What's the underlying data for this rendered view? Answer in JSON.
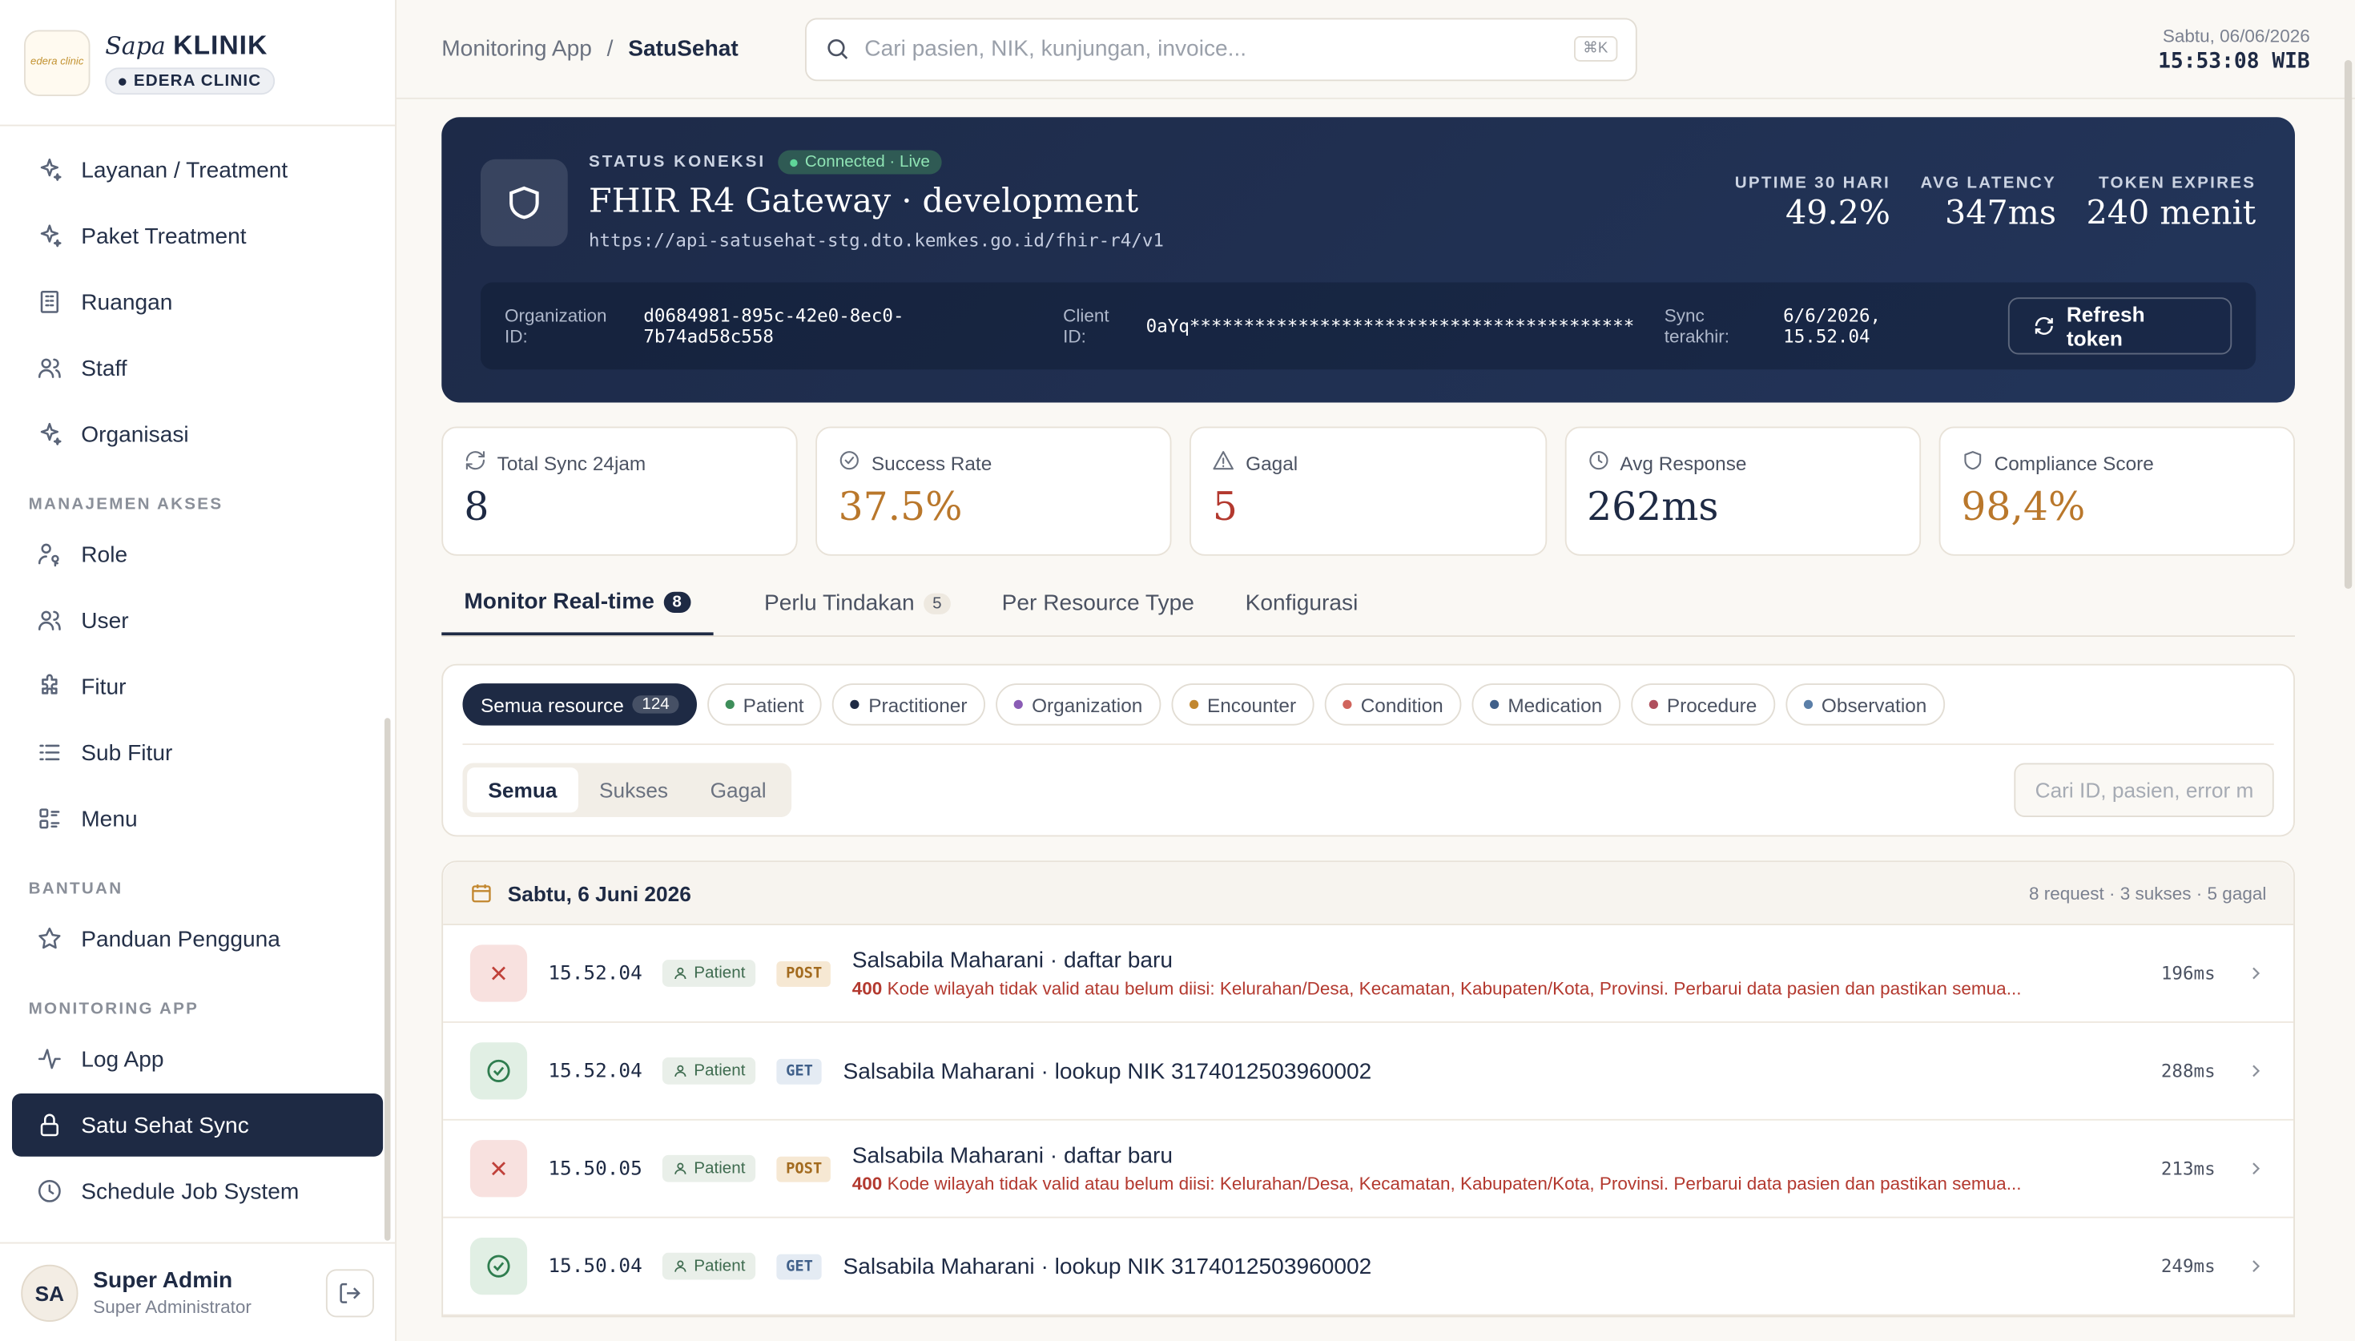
{
  "brand": {
    "name_italic": "Sapa",
    "name_bold": "KLINIK",
    "clinic": "EDERA CLINIC",
    "logo_text": "edera clinic"
  },
  "sidebar": {
    "items_top": [
      {
        "label": "Layanan / Treatment",
        "icon": "sparkle-icon"
      },
      {
        "label": "Paket Treatment",
        "icon": "sparkle-icon"
      },
      {
        "label": "Ruangan",
        "icon": "building-icon"
      },
      {
        "label": "Staff",
        "icon": "users-icon"
      },
      {
        "label": "Organisasi",
        "icon": "sparkle-icon"
      }
    ],
    "section_akses": "MANAJEMEN AKSES",
    "items_akses": [
      {
        "label": "Role",
        "icon": "user-key-icon"
      },
      {
        "label": "User",
        "icon": "users-icon"
      },
      {
        "label": "Fitur",
        "icon": "puzzle-icon"
      },
      {
        "label": "Sub Fitur",
        "icon": "list-icon"
      },
      {
        "label": "Menu",
        "icon": "menu-grid-icon"
      }
    ],
    "section_bantuan": "BANTUAN",
    "items_bantuan": [
      {
        "label": "Panduan Pengguna",
        "icon": "star-icon"
      }
    ],
    "section_monitoring": "MONITORING APP",
    "items_monitoring": [
      {
        "label": "Log App",
        "icon": "activity-icon"
      },
      {
        "label": "Satu Sehat Sync",
        "icon": "lock-icon",
        "active": true
      },
      {
        "label": "Schedule Job System",
        "icon": "clock-icon"
      }
    ]
  },
  "user": {
    "initials": "SA",
    "name": "Super Admin",
    "role": "Super Administrator"
  },
  "topbar": {
    "crumb_parent": "Monitoring App",
    "crumb_sep": "/",
    "crumb_current": "SatuSehat",
    "search_placeholder": "Cari pasien, NIK, kunjungan, invoice...",
    "shortcut": "⌘K",
    "date": "Sabtu, 06/06/2026",
    "time": "15:53:08 WIB"
  },
  "hero": {
    "status_label": "STATUS KONEKSI",
    "status_pill": "Connected · Live",
    "gateway": "FHIR R4 Gateway · development",
    "url": "https://api-satusehat-stg.dto.kemkes.go.id/fhir-r4/v1",
    "metrics": [
      {
        "label": "UPTIME 30 HARI",
        "value": "49.2%"
      },
      {
        "label": "AVG LATENCY",
        "value": "347ms"
      },
      {
        "label": "TOKEN EXPIRES",
        "value": "240 menit"
      }
    ],
    "org_label": "Organization ID:",
    "org_value": "d0684981-895c-42e0-8ec0-7b74ad58c558",
    "client_label": "Client ID:",
    "client_value": "0aYq*****************************************",
    "sync_label": "Sync terakhir:",
    "sync_value": "6/6/2026, 15.52.04",
    "refresh_label": "Refresh token"
  },
  "stats": [
    {
      "label": "Total Sync 24jam",
      "value": "8",
      "icon": "refresh-icon",
      "color": "#1e2a44"
    },
    {
      "label": "Success Rate",
      "value": "37.5%",
      "icon": "check-circle-icon",
      "color": "#b9772b"
    },
    {
      "label": "Gagal",
      "value": "5",
      "icon": "warning-icon",
      "color": "#b3392f"
    },
    {
      "label": "Avg Response",
      "value": "262ms",
      "icon": "clock-icon",
      "color": "#1e2a44"
    },
    {
      "label": "Compliance Score",
      "value": "98,4%",
      "icon": "shield-icon",
      "color": "#b9772b"
    }
  ],
  "tabs": [
    {
      "label": "Monitor Real-time",
      "count": "8",
      "active": true
    },
    {
      "label": "Perlu Tindakan",
      "count": "5"
    },
    {
      "label": "Per Resource Type"
    },
    {
      "label": "Konfigurasi"
    }
  ],
  "chips": [
    {
      "label": "Semua resource",
      "count": "124",
      "active": true
    },
    {
      "label": "Patient",
      "color": "#3e8e5a"
    },
    {
      "label": "Practitioner",
      "color": "#1e2a44"
    },
    {
      "label": "Organization",
      "color": "#8a5cb5"
    },
    {
      "label": "Encounter",
      "color": "#c2872f"
    },
    {
      "label": "Condition",
      "color": "#d0645c"
    },
    {
      "label": "Medication",
      "color": "#40608a"
    },
    {
      "label": "Procedure",
      "color": "#b0505e"
    },
    {
      "label": "Observation",
      "color": "#5b7fa8"
    }
  ],
  "segments": [
    {
      "label": "Semua",
      "active": true
    },
    {
      "label": "Sukses"
    },
    {
      "label": "Gagal"
    }
  ],
  "filter_placeholder": "Cari ID, pasien, error m",
  "log": {
    "date": "Sabtu, 6 Juni 2026",
    "summary": "8 request · 3 sukses · 5 gagal",
    "rows": [
      {
        "status": "fail",
        "time": "15.52.04",
        "resource": "Patient",
        "method": "POST",
        "title": "Salsabila Maharani · daftar baru",
        "err_code": "400",
        "err": "Kode wilayah tidak valid atau belum diisi: Kelurahan/Desa, Kecamatan, Kabupaten/Kota, Provinsi. Perbarui data pasien dan pastikan semua...",
        "ms": "196ms"
      },
      {
        "status": "ok",
        "time": "15.52.04",
        "resource": "Patient",
        "method": "GET",
        "title": "Salsabila Maharani · lookup NIK 3174012503960002",
        "ms": "288ms"
      },
      {
        "status": "fail",
        "time": "15.50.05",
        "resource": "Patient",
        "method": "POST",
        "title": "Salsabila Maharani · daftar baru",
        "err_code": "400",
        "err": "Kode wilayah tidak valid atau belum diisi: Kelurahan/Desa, Kecamatan, Kabupaten/Kota, Provinsi. Perbarui data pasien dan pastikan semua...",
        "ms": "213ms"
      },
      {
        "status": "ok",
        "time": "15.50.04",
        "resource": "Patient",
        "method": "GET",
        "title": "Salsabila Maharani · lookup NIK 3174012503960002",
        "ms": "249ms"
      }
    ]
  }
}
